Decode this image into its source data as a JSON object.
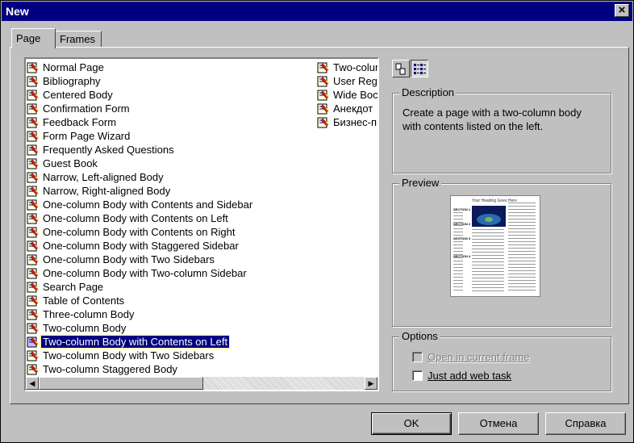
{
  "window": {
    "title": "New",
    "close_label": "×"
  },
  "tabs": [
    {
      "label": "Page",
      "active": true
    },
    {
      "label": "Frames",
      "active": false
    }
  ],
  "templates": {
    "column1": [
      "Normal Page",
      "Bibliography",
      "Centered Body",
      "Confirmation Form",
      "Feedback Form",
      "Form Page Wizard",
      "Frequently Asked Questions",
      "Guest Book",
      "Narrow, Left-aligned Body",
      "Narrow, Right-aligned Body",
      "One-column Body with Contents and Sidebar",
      "One-column Body with Contents on Left",
      "One-column Body with Contents on Right",
      "One-column Body with Staggered Sidebar",
      "One-column Body with Two Sidebars",
      "One-column Body with Two-column Sidebar",
      "Search Page",
      "Table of Contents",
      "Three-column Body",
      "Two-column Body",
      "Two-column Body with Contents on Left",
      "Two-column Body with Two Sidebars",
      "Two-column Staggered Body"
    ],
    "column2": [
      "Two-colum",
      "User Reg",
      "Wide Boc",
      "Анекдот",
      "Бизнес-п"
    ],
    "selected": "Two-column Body with Contents on Left"
  },
  "scrollbar": {
    "left_arrow": "◀",
    "right_arrow": "▶"
  },
  "description": {
    "title": "Description",
    "line1": "Create a page with a two-column body",
    "line2": "with contents listed on the left."
  },
  "preview": {
    "title": "Preview",
    "heading": "Your Heading Goes Here",
    "section_labels": [
      "SECTION 1",
      "SECTION 2",
      "SECTION 3",
      "SECTION 4"
    ]
  },
  "options": {
    "title": "Options",
    "open_in_frame": {
      "label": "Open in current frame",
      "enabled": false,
      "checked": false
    },
    "just_add_task": {
      "label": "Just add web task",
      "enabled": true,
      "checked": false
    }
  },
  "buttons": {
    "ok": "OK",
    "cancel": "Отмена",
    "help": "Справка"
  },
  "colors": {
    "selection": "#000080",
    "face": "#c0c0c0",
    "titlebar": "#000080"
  }
}
